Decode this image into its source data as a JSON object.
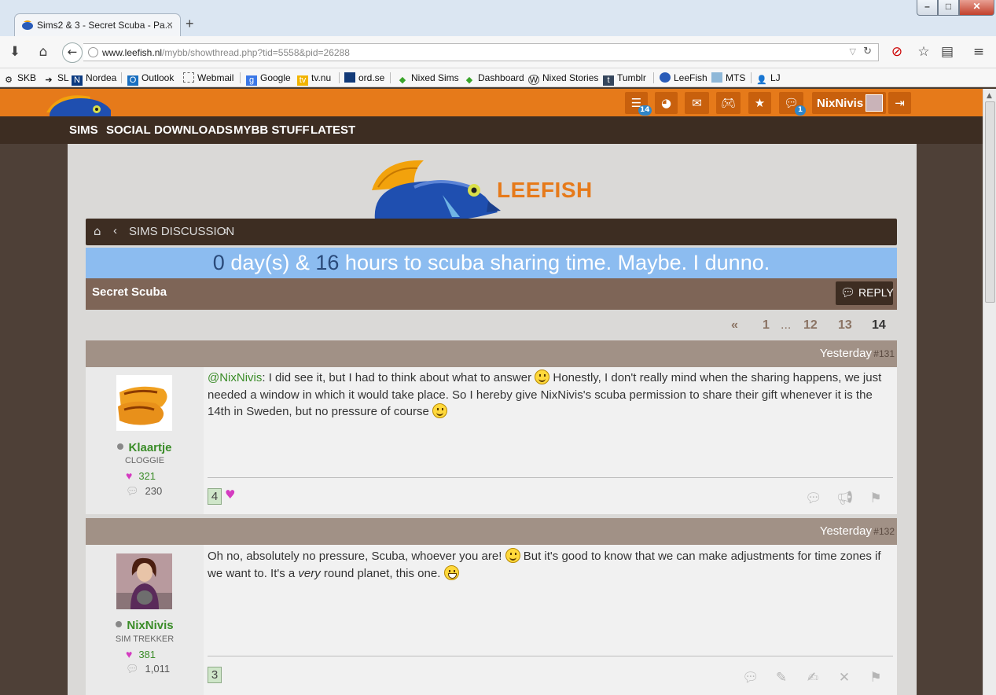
{
  "browser": {
    "tab_title": "Sims2 & 3 - Secret Scuba - Pa...",
    "tab_close": "×",
    "new_tab": "+",
    "url_host": "www.leefish.nl",
    "url_path": "/mybb/showthread.php?tid=5558&pid=26288",
    "window_controls": {
      "minimize": "–",
      "maximize": "□",
      "close": "✕"
    }
  },
  "bookmarks": [
    {
      "label": "SKB",
      "icon": "gear-icon"
    },
    {
      "label": "SL",
      "icon": "arrow-icon"
    },
    {
      "label": "Nordea",
      "icon": "nordea-icon"
    },
    {
      "label": "Outlook",
      "icon": "outlook-icon"
    },
    {
      "label": "Webmail",
      "icon": "webmail-icon"
    },
    {
      "label": "Google",
      "icon": "google-icon"
    },
    {
      "label": "tv.nu",
      "icon": "tv-icon"
    },
    {
      "label": "ord.se",
      "icon": "ordse-icon"
    },
    {
      "label": "Nixed Sims",
      "icon": "plumbob-icon"
    },
    {
      "label": "Dashboard",
      "icon": "plumbob-icon"
    },
    {
      "label": "Nixed Stories",
      "icon": "wordpress-icon"
    },
    {
      "label": "Tumblr",
      "icon": "tumblr-icon"
    },
    {
      "label": "LeeFish",
      "icon": "leefish-icon"
    },
    {
      "label": "MTS",
      "icon": "mts-icon"
    },
    {
      "label": "LJ",
      "icon": "lj-icon"
    }
  ],
  "header": {
    "brand": "LEEFISH",
    "username": "NixNivis",
    "badges": {
      "list": "14",
      "messages": "1"
    }
  },
  "nav": [
    "SIMS",
    "SOCIAL",
    "DOWNLOADS",
    "MYBB STUFF",
    "LATEST"
  ],
  "breadcrumb": {
    "forum": "SIMS DISCUSSION"
  },
  "countdown": {
    "days": "0",
    "days_label": "day(s) &",
    "hours": "16",
    "hours_label": "hours to scuba sharing time. Maybe. I dunno."
  },
  "thread": {
    "title": "Secret Scuba",
    "reply_label": "REPLY"
  },
  "pagination": {
    "prev": "«",
    "first": "1",
    "dots": "...",
    "p12": "12",
    "p13": "13",
    "current": "14"
  },
  "posts": [
    {
      "date": "Yesterday",
      "number": "#131",
      "user": "Klaartje",
      "user_title": "CLOGGIE",
      "likes": "321",
      "post_count": "230",
      "mention": "@NixNivis",
      "text_1": ": I did see it, but I had to think about what to answer ",
      "text_2": " Honestly, I don't really mind when the sharing happens, we just needed a window in which it would take place. So I hereby give NixNivis's scuba permission to share their gift whenever it is the 14th in Sweden, but no pressure of course ",
      "like_count": "4"
    },
    {
      "date": "Yesterday",
      "number": "#132",
      "user": "NixNivis",
      "user_title": "SIM TREKKER",
      "likes": "381",
      "post_count": "1,011",
      "text_1": "Oh no, absolutely no pressure, Scuba, whoever you are! ",
      "text_2": " But it's good to know that we can make adjustments for time zones if we want to. It's a ",
      "text_em": "very",
      "text_3": " round planet, this one. ",
      "like_count": "3"
    }
  ],
  "colors": {
    "header_orange": "#e67a1a",
    "nav_brown": "#3d2d22",
    "countdown_blue": "#8cbcf0",
    "thread_bar": "#7e6557",
    "username_green": "#3a8c28",
    "heart_pink": "#d43bc0"
  }
}
